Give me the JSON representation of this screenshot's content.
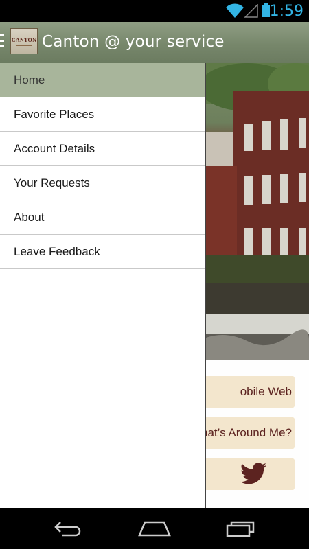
{
  "status_bar": {
    "time": "1:59",
    "icons": [
      "wifi-icon",
      "signal-icon",
      "battery-icon"
    ],
    "clock_color": "#33b5e5"
  },
  "action_bar": {
    "title": "Canton @ your service",
    "logo_text": "CANTON",
    "icons": [
      "hamburger-icon",
      "app-logo"
    ]
  },
  "drawer": {
    "items": [
      {
        "label": "Home",
        "active": true
      },
      {
        "label": "Favorite Places"
      },
      {
        "label": "Account Details"
      },
      {
        "label": "Your Requests"
      },
      {
        "label": "About"
      },
      {
        "label": "Leave Feedback"
      }
    ],
    "active_color": "#a8b59b"
  },
  "background": {
    "cards": {
      "mobile_web": "obile Web",
      "whats_around": "nat’s Around Me?",
      "twitter_icon": "twitter-icon"
    },
    "card_color": "#f3e6cd",
    "card_text_color": "#5c2320"
  },
  "nav_bar": {
    "buttons": [
      "back-icon",
      "home-icon",
      "recent-apps-icon"
    ]
  }
}
